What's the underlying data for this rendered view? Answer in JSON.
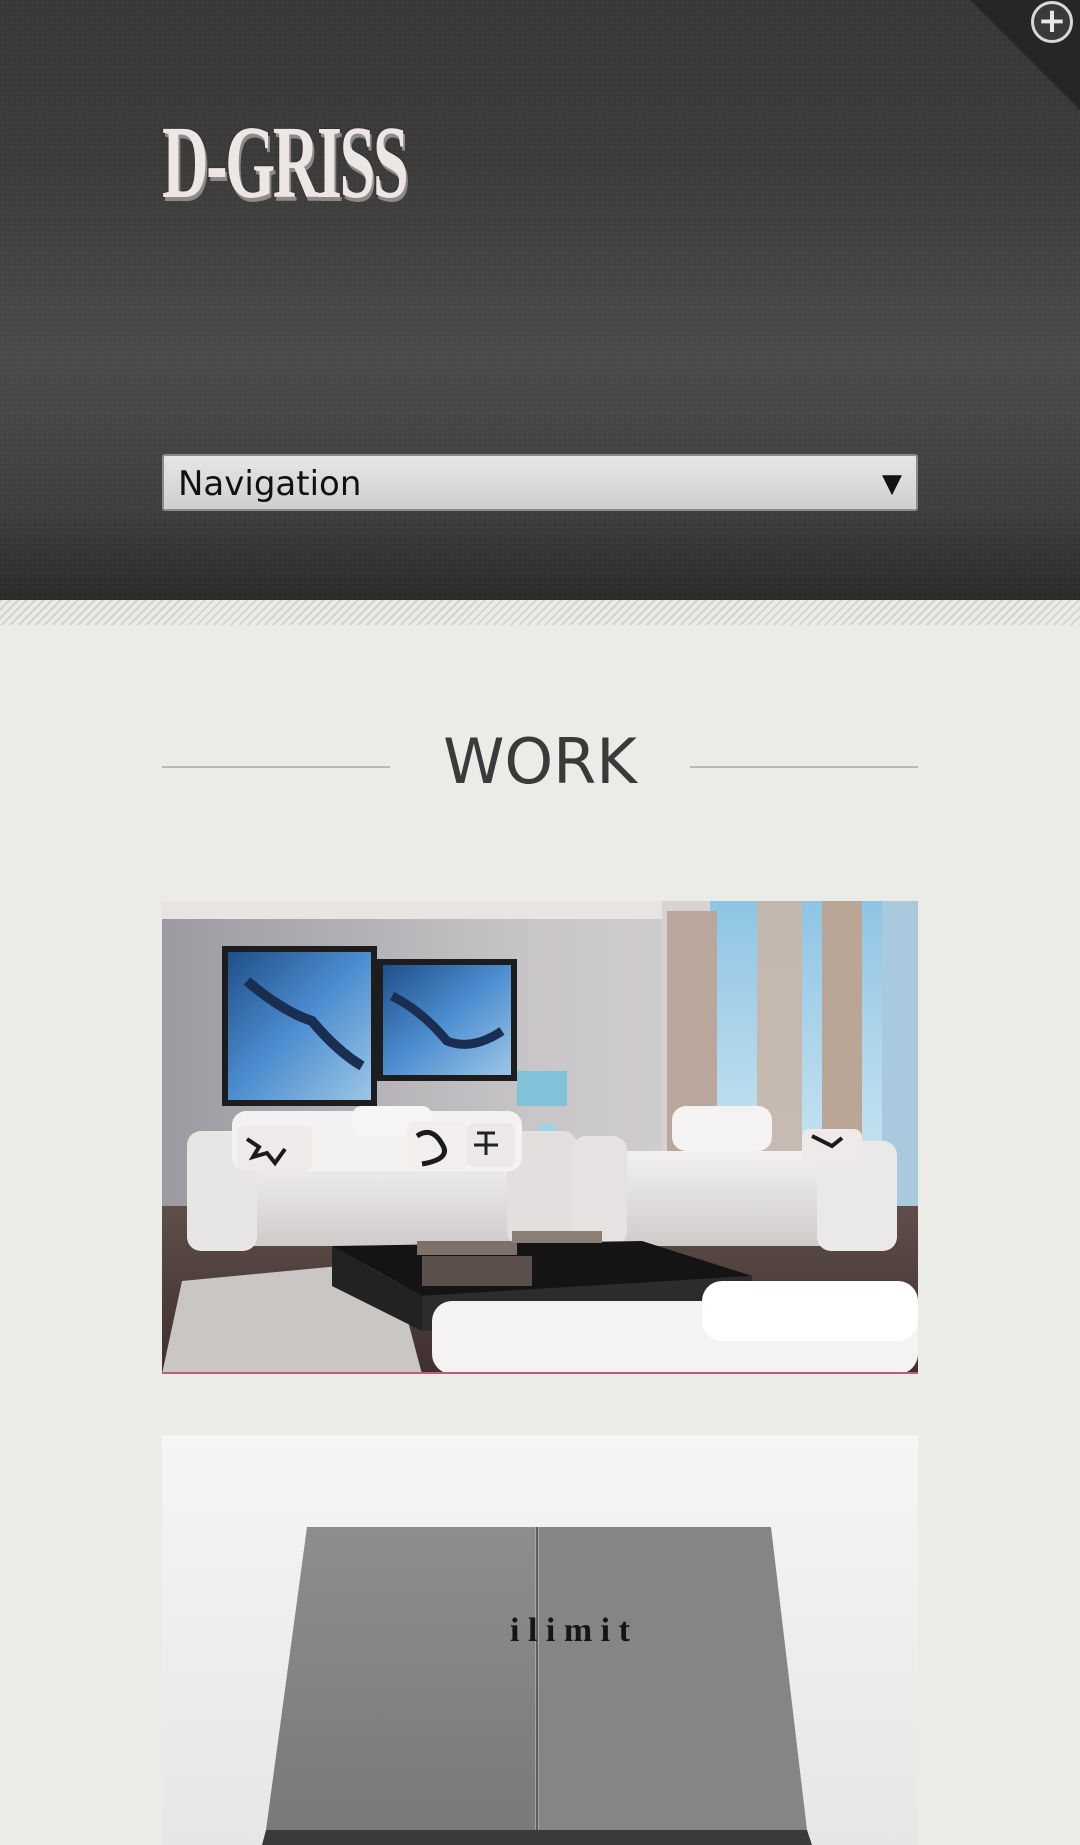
{
  "header": {
    "logo_text": "D-GRISS",
    "corner_icon": "plus-circle-icon",
    "navigation": {
      "selected_label": "Navigation",
      "arrow_glyph": "▼"
    }
  },
  "work": {
    "title": "WORK",
    "items": [
      {
        "image": "living-room-sofas-photo"
      },
      {
        "image": "ilimit-book-box-photo",
        "box_brand_text": "i l i m i t"
      }
    ]
  },
  "colors": {
    "header_bg": "#3a3a3a",
    "page_bg": "#ebebe8",
    "heading_text": "#3a3a3a",
    "image_underline": "#c25a7a"
  }
}
